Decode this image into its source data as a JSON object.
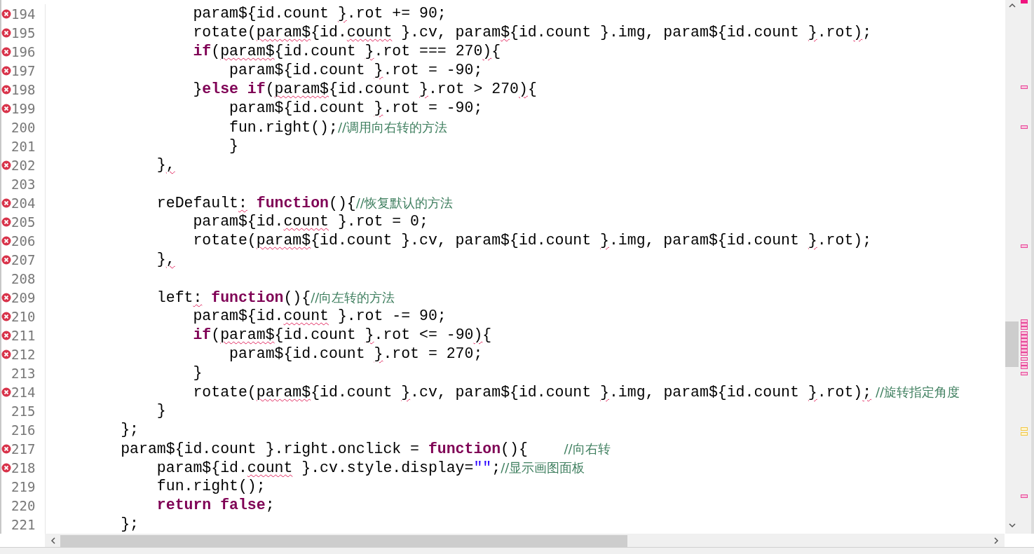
{
  "lines": [
    {
      "number": "194",
      "error": true,
      "segments": [
        {
          "kind": "plain",
          "text": "                param${id.count "
        },
        {
          "kind": "error",
          "text": "}"
        },
        {
          "kind": "plain",
          "text": ".rot += 90;"
        }
      ]
    },
    {
      "number": "195",
      "error": true,
      "segments": [
        {
          "kind": "plain",
          "text": "                rotate("
        },
        {
          "kind": "error",
          "text": "param$"
        },
        {
          "kind": "plain",
          "text": "{id."
        },
        {
          "kind": "error",
          "text": "count"
        },
        {
          "kind": "plain",
          "text": " }.cv, param"
        },
        {
          "kind": "error",
          "text": "$"
        },
        {
          "kind": "plain",
          "text": "{id.count }.img, param${id.count "
        },
        {
          "kind": "error",
          "text": "}"
        },
        {
          "kind": "plain",
          "text": ".rot"
        },
        {
          "kind": "error",
          "text": ")"
        },
        {
          "kind": "plain",
          "text": ";"
        }
      ]
    },
    {
      "number": "196",
      "error": true,
      "segments": [
        {
          "kind": "keyword",
          "text": "                if"
        },
        {
          "kind": "plain",
          "text": "("
        },
        {
          "kind": "error",
          "text": "param$"
        },
        {
          "kind": "plain",
          "text": "{id.count "
        },
        {
          "kind": "error",
          "text": "}"
        },
        {
          "kind": "plain",
          "text": ".rot === 270"
        },
        {
          "kind": "error",
          "text": ")"
        },
        {
          "kind": "plain",
          "text": "{"
        }
      ]
    },
    {
      "number": "197",
      "error": true,
      "segments": [
        {
          "kind": "plain",
          "text": "                    param${id.count "
        },
        {
          "kind": "error",
          "text": "}"
        },
        {
          "kind": "plain",
          "text": ".rot = -90;"
        }
      ]
    },
    {
      "number": "198",
      "error": true,
      "segments": [
        {
          "kind": "plain",
          "text": "                }"
        },
        {
          "kind": "keyword",
          "text": "else if"
        },
        {
          "kind": "plain",
          "text": "("
        },
        {
          "kind": "error",
          "text": "param$"
        },
        {
          "kind": "plain",
          "text": "{id.count "
        },
        {
          "kind": "error",
          "text": "}"
        },
        {
          "kind": "plain",
          "text": ".rot > 270"
        },
        {
          "kind": "error",
          "text": ")"
        },
        {
          "kind": "plain",
          "text": "{"
        }
      ]
    },
    {
      "number": "199",
      "error": true,
      "segments": [
        {
          "kind": "plain",
          "text": "                    param${id.count "
        },
        {
          "kind": "error",
          "text": "}"
        },
        {
          "kind": "plain",
          "text": ".rot = -90;"
        }
      ]
    },
    {
      "number": "200",
      "error": false,
      "segments": [
        {
          "kind": "plain",
          "text": "                    fun.right();"
        },
        {
          "kind": "comment",
          "text": "//调用向右转的方法"
        }
      ]
    },
    {
      "number": "201",
      "error": false,
      "segments": [
        {
          "kind": "plain",
          "text": "                    }"
        }
      ]
    },
    {
      "number": "202",
      "error": true,
      "segments": [
        {
          "kind": "plain",
          "text": "            }"
        },
        {
          "kind": "error",
          "text": ","
        }
      ]
    },
    {
      "number": "203",
      "error": false
    },
    {
      "number": "204",
      "error": true,
      "segments": [
        {
          "kind": "plain",
          "text": "            reDefault"
        },
        {
          "kind": "error",
          "text": ":"
        },
        {
          "kind": "keyword",
          "text": " function"
        },
        {
          "kind": "plain",
          "text": "(){"
        },
        {
          "kind": "comment",
          "text": "//恢复默认的方法"
        }
      ]
    },
    {
      "number": "205",
      "error": true,
      "segments": [
        {
          "kind": "plain",
          "text": "                param${id."
        },
        {
          "kind": "error",
          "text": "count"
        },
        {
          "kind": "plain",
          "text": " }.rot = 0;"
        }
      ]
    },
    {
      "number": "206",
      "error": true,
      "segments": [
        {
          "kind": "plain",
          "text": "                rotate("
        },
        {
          "kind": "error",
          "text": "param$"
        },
        {
          "kind": "plain",
          "text": "{id.count }.cv, param${id.count "
        },
        {
          "kind": "error",
          "text": "}"
        },
        {
          "kind": "plain",
          "text": ".img, param${id.count "
        },
        {
          "kind": "error",
          "text": "}"
        },
        {
          "kind": "plain",
          "text": ".rot);"
        }
      ]
    },
    {
      "number": "207",
      "error": true,
      "segments": [
        {
          "kind": "plain",
          "text": "            }"
        },
        {
          "kind": "error",
          "text": ","
        }
      ]
    },
    {
      "number": "208",
      "error": false
    },
    {
      "number": "209",
      "error": true,
      "segments": [
        {
          "kind": "plain",
          "text": "            left"
        },
        {
          "kind": "error",
          "text": ":"
        },
        {
          "kind": "keyword",
          "text": " function"
        },
        {
          "kind": "plain",
          "text": "(){"
        },
        {
          "kind": "comment",
          "text": "//向左转的方法"
        }
      ]
    },
    {
      "number": "210",
      "error": true,
      "segments": [
        {
          "kind": "plain",
          "text": "                param${id."
        },
        {
          "kind": "error",
          "text": "count"
        },
        {
          "kind": "plain",
          "text": " }.rot -= 90;"
        }
      ]
    },
    {
      "number": "211",
      "error": true,
      "segments": [
        {
          "kind": "keyword",
          "text": "                if"
        },
        {
          "kind": "plain",
          "text": "("
        },
        {
          "kind": "error",
          "text": "param$"
        },
        {
          "kind": "plain",
          "text": "{id.count "
        },
        {
          "kind": "error",
          "text": "}"
        },
        {
          "kind": "plain",
          "text": ".rot <= -90"
        },
        {
          "kind": "error",
          "text": ")"
        },
        {
          "kind": "plain",
          "text": "{"
        }
      ]
    },
    {
      "number": "212",
      "error": true,
      "segments": [
        {
          "kind": "plain",
          "text": "                    param${id.count "
        },
        {
          "kind": "error",
          "text": "}"
        },
        {
          "kind": "plain",
          "text": ".rot = 270;"
        }
      ]
    },
    {
      "number": "213",
      "error": false,
      "segments": [
        {
          "kind": "plain",
          "text": "                }"
        }
      ]
    },
    {
      "number": "214",
      "error": true,
      "segments": [
        {
          "kind": "plain",
          "text": "                rotate("
        },
        {
          "kind": "error",
          "text": "param$"
        },
        {
          "kind": "plain",
          "text": "{id.count "
        },
        {
          "kind": "error",
          "text": "}"
        },
        {
          "kind": "plain",
          "text": ".cv, param${id.count "
        },
        {
          "kind": "error",
          "text": "}"
        },
        {
          "kind": "plain",
          "text": ".img, param${id.count "
        },
        {
          "kind": "error",
          "text": "}"
        },
        {
          "kind": "plain",
          "text": ".rot)"
        },
        {
          "kind": "error",
          "text": ";"
        },
        {
          "kind": "comment",
          "text": " //旋转指定角度"
        }
      ]
    },
    {
      "number": "215",
      "error": false,
      "segments": [
        {
          "kind": "plain",
          "text": "            }"
        }
      ]
    },
    {
      "number": "216",
      "error": false,
      "segments": [
        {
          "kind": "plain",
          "text": "        };"
        }
      ]
    },
    {
      "number": "217",
      "error": true,
      "segments": [
        {
          "kind": "plain",
          "text": "        param${id.count }.right.onclick = "
        },
        {
          "kind": "keyword",
          "text": "function"
        },
        {
          "kind": "plain",
          "text": "(){    "
        },
        {
          "kind": "comment",
          "text": "//向右转"
        }
      ]
    },
    {
      "number": "218",
      "error": true,
      "segments": [
        {
          "kind": "plain",
          "text": "            param${id."
        },
        {
          "kind": "error",
          "text": "count"
        },
        {
          "kind": "plain",
          "text": " }.cv.style.display="
        },
        {
          "kind": "string",
          "text": "\"\""
        },
        {
          "kind": "plain",
          "text": ";"
        },
        {
          "kind": "comment",
          "text": "//显示画图面板"
        }
      ]
    },
    {
      "number": "219",
      "error": false,
      "segments": [
        {
          "kind": "plain",
          "text": "            fun.right();"
        }
      ]
    },
    {
      "number": "220",
      "error": false,
      "segments": [
        {
          "kind": "keyword",
          "text": "            return false"
        },
        {
          "kind": "plain",
          "text": ";"
        }
      ]
    },
    {
      "number": "221",
      "error": false,
      "segments": [
        {
          "kind": "plain",
          "text": "        };"
        }
      ]
    }
  ]
}
